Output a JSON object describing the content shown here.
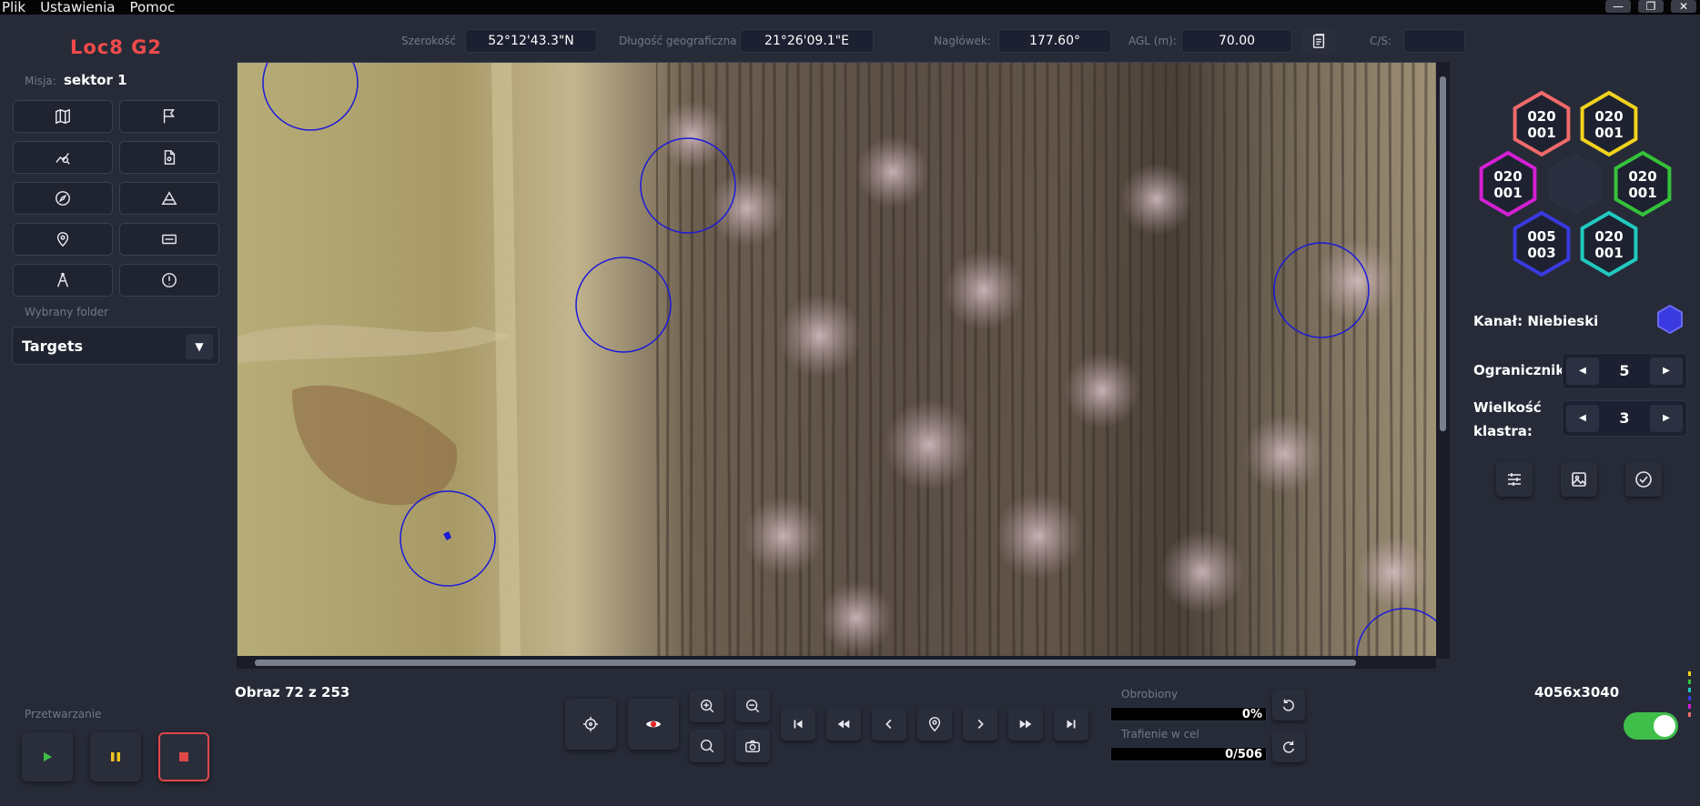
{
  "menu": {
    "items": [
      "Plik",
      "Ustawienia",
      "Pomoc"
    ]
  },
  "window_controls": {
    "minimize": "—",
    "maximize": "❐",
    "close": "✕"
  },
  "app": {
    "title": "Loc8 G2"
  },
  "mission": {
    "label": "Misja:",
    "value": "sektor 1"
  },
  "toolbar": {
    "icons": [
      "map-icon",
      "flag-icon",
      "route-search-icon",
      "report-file-icon",
      "compass-icon",
      "area-icon",
      "location-pin-icon",
      "width-icon",
      "drone-icon",
      "alert-icon"
    ]
  },
  "folder": {
    "label": "Wybrany folder",
    "value": "Targets"
  },
  "processing": {
    "label": "Przetwarzanie"
  },
  "telemetry": {
    "lat_label": "Szerokość",
    "lat_value": "52°12'43.3\"N",
    "lon_label": "Długość geograficzna",
    "lon_value": "21°26'09.1\"E",
    "heading_label": "Nagłówek:",
    "heading_value": "177.60°",
    "agl_label": "AGL (m):",
    "agl_value": "70.00",
    "cs_label": "C/S:",
    "cs_value": ""
  },
  "viewer": {
    "image_counter": "Obraz 72 z 253",
    "resolution": "4056x3040"
  },
  "progress": {
    "processed_label": "Obrobiony",
    "processed_value": "0%",
    "processed_fraction": 0,
    "hits_label": "Trafienie w cel",
    "hits_value": "0/506",
    "hits_fraction": 0
  },
  "channels": [
    {
      "top": "020",
      "bottom": "001",
      "color": "#f06a6a"
    },
    {
      "top": "020",
      "bottom": "001",
      "color": "#f2d21e"
    },
    {
      "top": "020",
      "bottom": "001",
      "color": "#d41fd4"
    },
    {
      "top": "020",
      "bottom": "001",
      "color": "#35c23a"
    },
    {
      "top": "005",
      "bottom": "003",
      "color": "#3a3ae0"
    },
    {
      "top": "020",
      "bottom": "001",
      "color": "#20c9c0"
    }
  ],
  "channel": {
    "label": "Kanał:",
    "value": "Niebieski",
    "color": "#3a3ae0"
  },
  "limiter": {
    "label": "Ogranicznik:",
    "value": "5"
  },
  "cluster": {
    "label_line1": "Wielkość",
    "label_line2": "klastra:",
    "value": "3"
  },
  "toggle": {
    "on": true,
    "color": "#3fbf4a"
  }
}
